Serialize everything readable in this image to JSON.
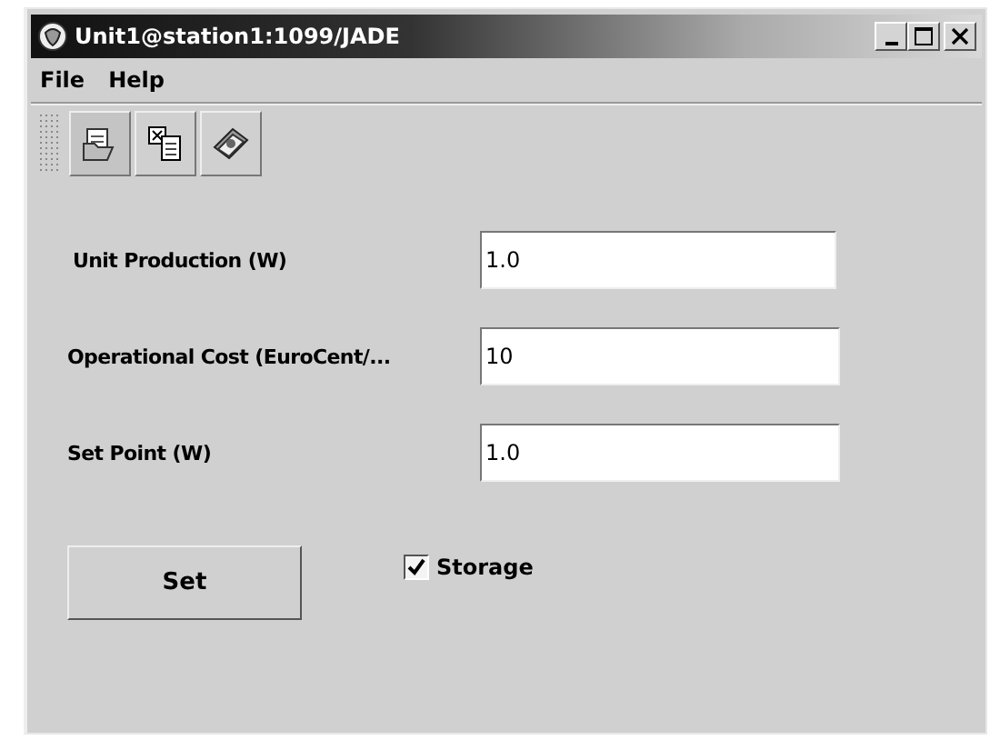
{
  "window": {
    "title": "Unit1@station1:1099/JADE"
  },
  "menu": [
    "File",
    "Help"
  ],
  "fields": [
    {
      "label": "Unit Production (W)",
      "value": "1.0"
    },
    {
      "label": "Operational Cost (EuroCent/...",
      "value": "10"
    },
    {
      "label": "Set Point (W)",
      "value": "1.0"
    }
  ],
  "button": "Set",
  "checkbox": {
    "label": "Storage",
    "checked": true
  }
}
